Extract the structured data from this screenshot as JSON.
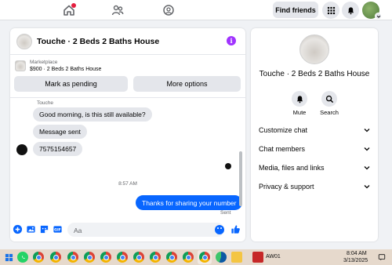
{
  "colors": {
    "accent": "#0866ff",
    "info": "#a033ff",
    "notification": "#e41e3f",
    "taskbar": "#e6d9cc"
  },
  "topnav": {
    "icons": [
      "home-icon",
      "groups-icon",
      "gaming-icon"
    ],
    "find_friends_label": "Find friends",
    "right_icons": [
      "menu-grid-icon",
      "notifications-bell-icon",
      "profile-avatar"
    ]
  },
  "chat": {
    "title": "Touche · 2 Beds 2 Baths House",
    "listing": {
      "label": "Marketplace",
      "price_title": "$900 · 2 Beds 2 Baths House",
      "mark_pending_label": "Mark as pending",
      "more_options_label": "More options"
    },
    "sender_name": "Touche",
    "messages_in": [
      "Good morning, is this still available?",
      "Message sent",
      "7575154657"
    ],
    "timestamp": "8:57 AM",
    "message_out": "Thanks for sharing your number",
    "sent_status": "Sent",
    "composer": {
      "placeholder": "Aa",
      "icons": [
        "add-icon",
        "photo-icon",
        "sticker-icon",
        "gif-icon",
        "emoji-icon",
        "like-icon"
      ]
    }
  },
  "info_panel": {
    "name": "Touche · 2 Beds 2 Baths House",
    "actions": [
      {
        "label": "Mute",
        "icon": "bell-icon"
      },
      {
        "label": "Search",
        "icon": "search-icon"
      }
    ],
    "sections": [
      {
        "label": "Customize chat"
      },
      {
        "label": "Chat members"
      },
      {
        "label": "Media, files and links"
      },
      {
        "label": "Privacy & support"
      }
    ]
  },
  "taskbar": {
    "app_label": "AW01",
    "time": "8:04 AM",
    "date": "3/13/2025",
    "icons": [
      "windows-icon",
      "whatsapp-icon",
      "chrome-icon",
      "edge-icon",
      "file-explorer-icon"
    ]
  }
}
